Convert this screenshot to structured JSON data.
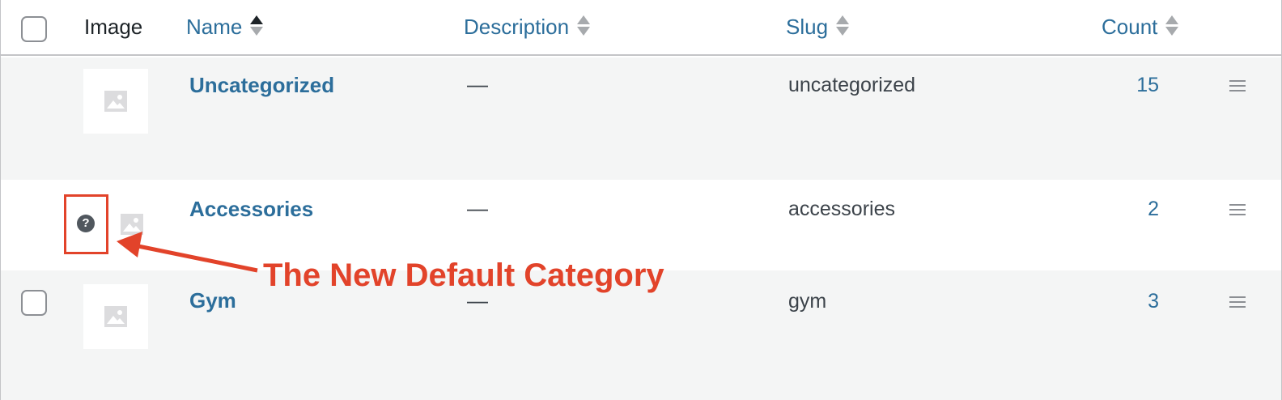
{
  "header": {
    "image_label": "Image",
    "name_label": "Name",
    "description_label": "Description",
    "slug_label": "Slug",
    "count_label": "Count"
  },
  "rows": [
    {
      "name": "Uncategorized",
      "description": "—",
      "slug": "uncategorized",
      "count": "15"
    },
    {
      "name": "Accessories",
      "description": "—",
      "slug": "accessories",
      "count": "2"
    },
    {
      "name": "Gym",
      "description": "—",
      "slug": "gym",
      "count": "3"
    }
  ],
  "annotation": {
    "text": "The New Default Category",
    "color": "#e2432a"
  },
  "help_icon_glyph": "?",
  "colors": {
    "link": "#2c6e9b",
    "alt_row": "#f4f5f5",
    "border": "#c3c4c7"
  }
}
